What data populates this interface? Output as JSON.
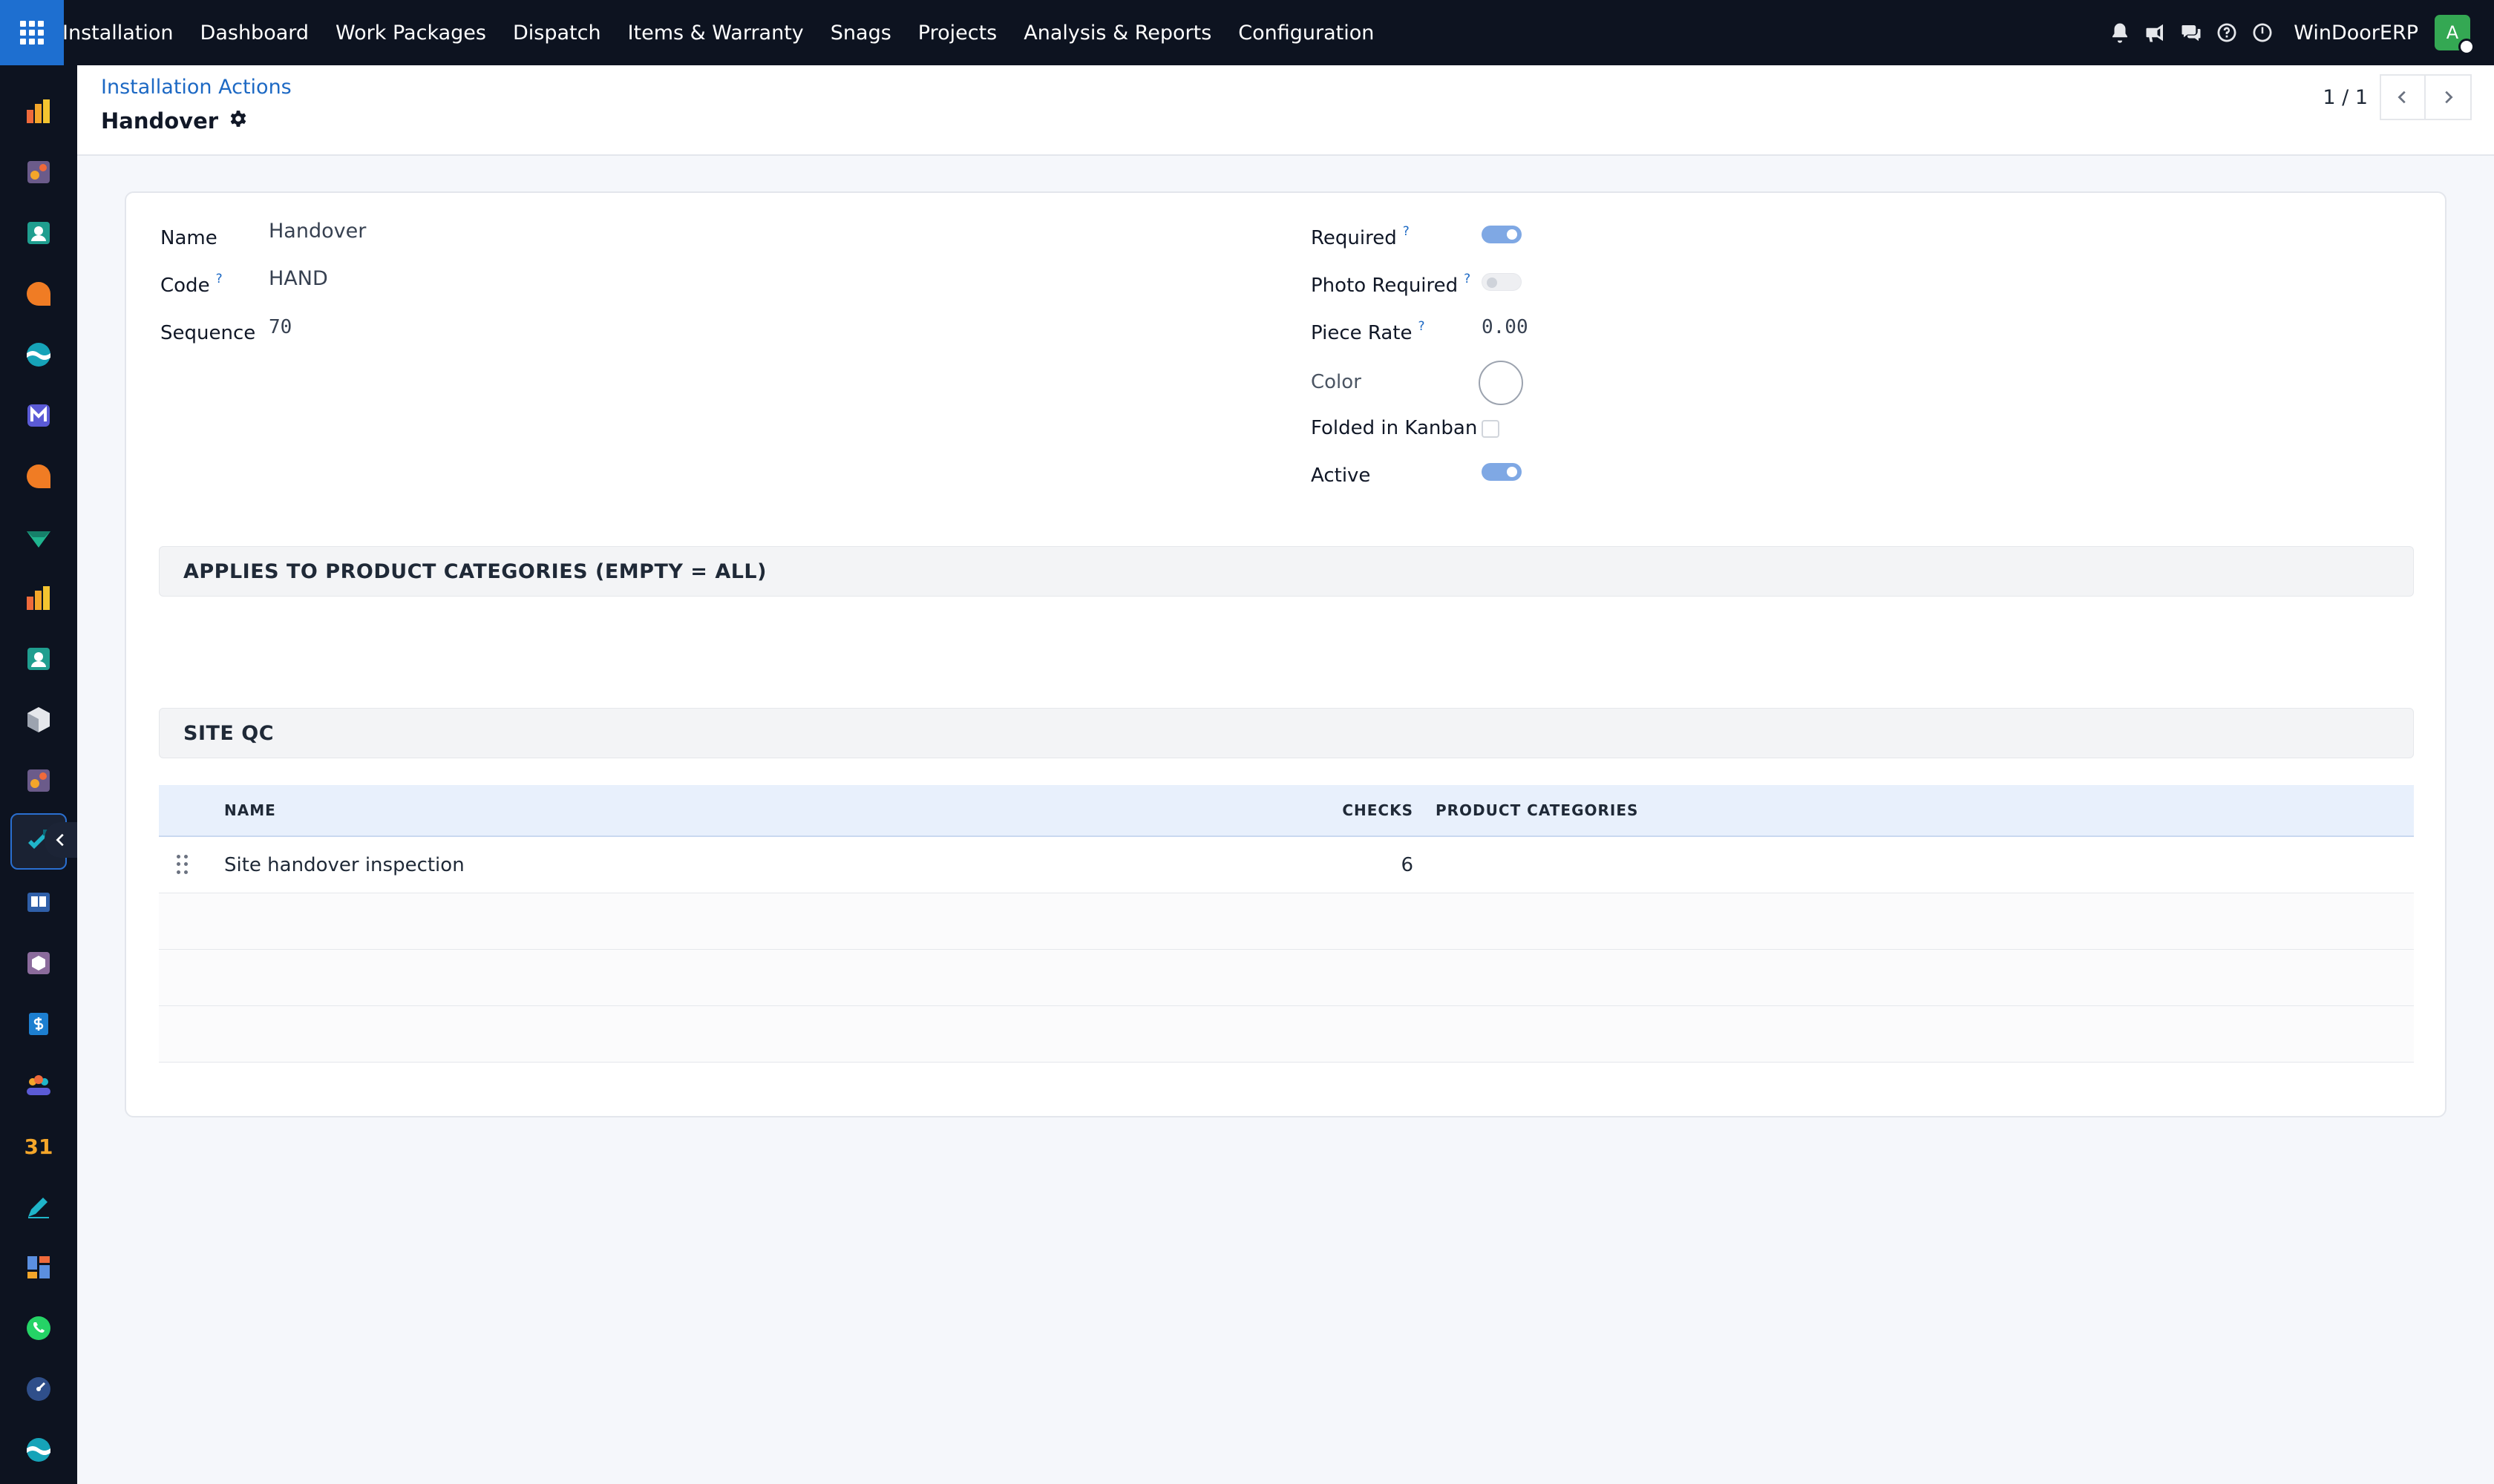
{
  "topbar": {
    "menu": [
      "Installation",
      "Dashboard",
      "Work Packages",
      "Dispatch",
      "Items & Warranty",
      "Snags",
      "Projects",
      "Analysis & Reports",
      "Configuration"
    ],
    "company": "WinDoorERP",
    "avatar_initial": "A",
    "icons": [
      "bell-icon",
      "megaphone-icon",
      "chat-icon",
      "help-icon",
      "clock-icon"
    ]
  },
  "control": {
    "breadcrumb": "Installation Actions",
    "title": "Handover",
    "pager": "1 / 1"
  },
  "form": {
    "name_label": "Name",
    "name_value": "Handover",
    "code_label": "Code",
    "code_value": "HAND",
    "sequence_label": "Sequence",
    "sequence_value": "70",
    "required_label": "Required",
    "required_on": true,
    "photo_required_label": "Photo Required",
    "photo_required_on": false,
    "piece_rate_label": "Piece Rate",
    "piece_rate_value": "0.00",
    "color_label": "Color",
    "folded_label": "Folded in Kanban",
    "folded_checked": false,
    "active_label": "Active",
    "active_on": true,
    "help_mark": "?"
  },
  "sections": {
    "categories_title": "APPLIES TO PRODUCT CATEGORIES (EMPTY = ALL)",
    "site_qc_title": "SITE QC"
  },
  "table": {
    "headers": {
      "name": "NAME",
      "checks": "CHECKS",
      "categories": "PRODUCT CATEGORIES"
    },
    "rows": [
      {
        "name": "Site handover inspection",
        "checks": "6",
        "categories": ""
      }
    ]
  },
  "colors": {
    "topbar_bg": "#0d1320",
    "apps_button": "#1e6fd0",
    "link": "#1d69c4",
    "toggle_on": "#7fa8e4",
    "avatar": "#34a853"
  }
}
